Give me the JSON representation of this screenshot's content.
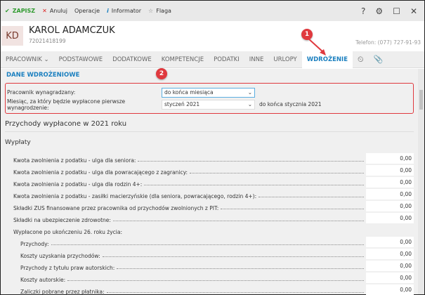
{
  "toolbar": {
    "save": "ZAPISZ",
    "cancel": "Anuluj",
    "operations": "Operacje",
    "informator": "Informator",
    "flag": "Flaga"
  },
  "header": {
    "initials": "KD",
    "name": "KAROL ADAMCZUK",
    "pesel": "72021418199",
    "phone": "Telefon: (077) 727-91-93"
  },
  "tabs": [
    "PRACOWNIK",
    "PODSTAWOWE",
    "DODATKOWE",
    "KOMPETENCJE",
    "PODATKI",
    "INNE",
    "URLOPY",
    "WDROŻENIE"
  ],
  "section": "DANE WDROŻENIOWE",
  "form": {
    "paid_label": "Pracownik wynagradzany:",
    "paid_value": "do końca miesiąca",
    "month_label": "Miesiąc, za który będzie wypłacone pierwsze wynagrodzenie:",
    "month_value": "styczeń 2021",
    "month_note": "do końca stycznia 2021"
  },
  "income_title": "Przychody wypłacone w 2021 roku",
  "payments_title": "Wypłaty",
  "rows": [
    {
      "label": "Kwota zwolnienia z podatku - ulga dla seniora:",
      "value": "0,00"
    },
    {
      "label": "Kwota zwolnienia z podatku - ulga dla powracającego z zagranicy:",
      "value": "0,00"
    },
    {
      "label": "Kwota zwolnienia z podatku - ulga dla rodzin 4+:",
      "value": "0,00"
    },
    {
      "label": "Kwota zwolnienia z podatku - zasiłki macierzyńskie (dla seniora, powracającego, rodzin 4+):",
      "value": "0,00"
    },
    {
      "label": "Składki ZUS finansowane przez pracownika od przychodów zwolnionych z PIT:",
      "value": "0,00"
    },
    {
      "label": "Składki na ubezpieczenie zdrowotne:",
      "value": "0,00"
    },
    {
      "label": "Wypłacone po ukończeniu 26. roku życia:"
    },
    {
      "label": "Przychody:",
      "value": "0,00"
    },
    {
      "label": "Koszty uzyskania przychodów:",
      "value": "0,00"
    },
    {
      "label": "Przychody z tytułu praw autorskich:",
      "value": "0,00"
    },
    {
      "label": "Koszty autorskie:",
      "value": "0,00"
    },
    {
      "label": "Zaliczki pobrane przez płatnika:",
      "value": "0,00"
    }
  ],
  "badges": [
    "1",
    "2"
  ]
}
